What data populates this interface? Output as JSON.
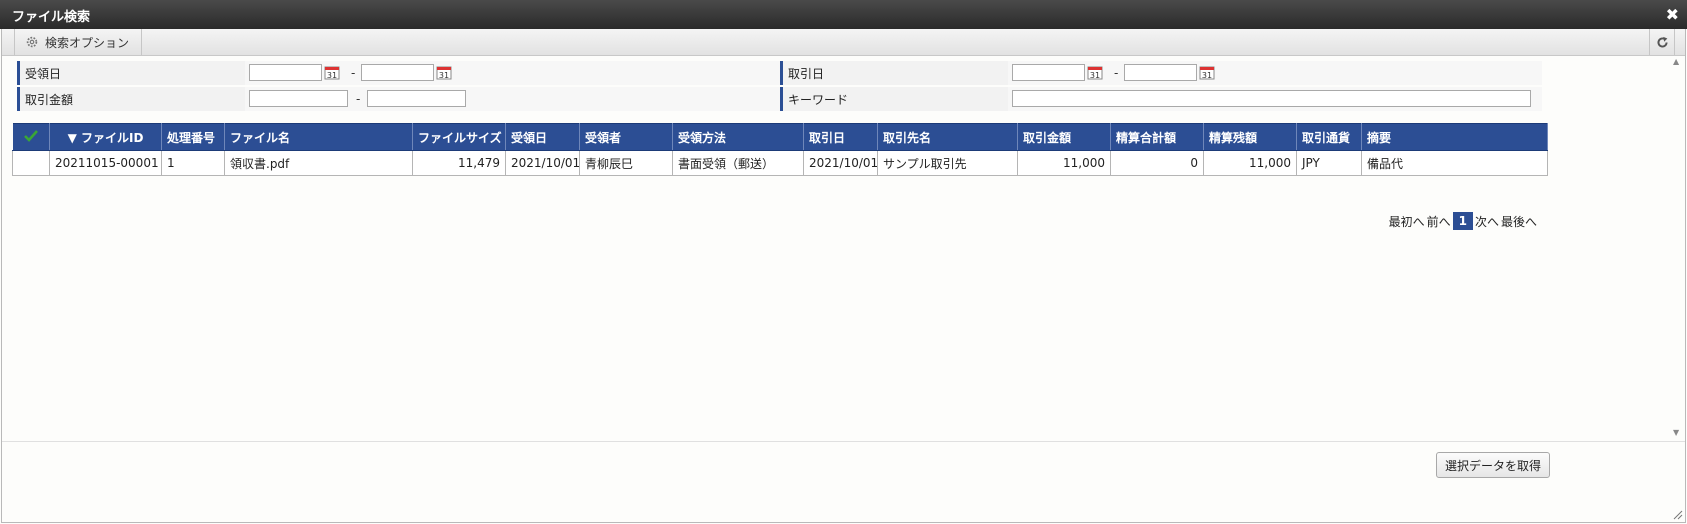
{
  "window": {
    "title": "ファイル検索"
  },
  "toolbar": {
    "options_label": "検索オプション"
  },
  "form": {
    "received_date": {
      "label": "受領日",
      "from": "",
      "to": ""
    },
    "transaction_date": {
      "label": "取引日",
      "from": "",
      "to": ""
    },
    "amount": {
      "label": "取引金額",
      "from": "",
      "to": ""
    },
    "keyword": {
      "label": "キーワード",
      "value": ""
    },
    "range_separator": "-",
    "calendar_day": "31"
  },
  "table": {
    "headers": [
      "",
      "▼ ファイルID",
      "処理番号",
      "ファイル名",
      "ファイルサイズ",
      "受領日",
      "受領者",
      "受領方法",
      "取引日",
      "取引先名",
      "取引金額",
      "精算合計額",
      "精算残額",
      "取引通貨",
      "摘要"
    ],
    "rows": [
      [
        "",
        "20211015-00001",
        "1",
        "領収書.pdf",
        "11,479",
        "2021/10/01",
        "青柳辰巳",
        "書面受領（郵送）",
        "2021/10/01",
        "サンプル取引先",
        "11,000",
        "0",
        "11,000",
        "JPY",
        "備品代"
      ]
    ]
  },
  "pager": {
    "first": "最初へ",
    "prev": "前へ",
    "current": "1",
    "next": "次へ",
    "last": "最後へ"
  },
  "footer": {
    "submit_label": "選択データを取得"
  },
  "colors": {
    "header_blue": "#2c4e94",
    "check_green": "#3aa636"
  },
  "icons": [
    "gear-icon",
    "refresh-icon",
    "close-icon",
    "calendar-icon",
    "check-icon",
    "sort-desc-icon"
  ]
}
